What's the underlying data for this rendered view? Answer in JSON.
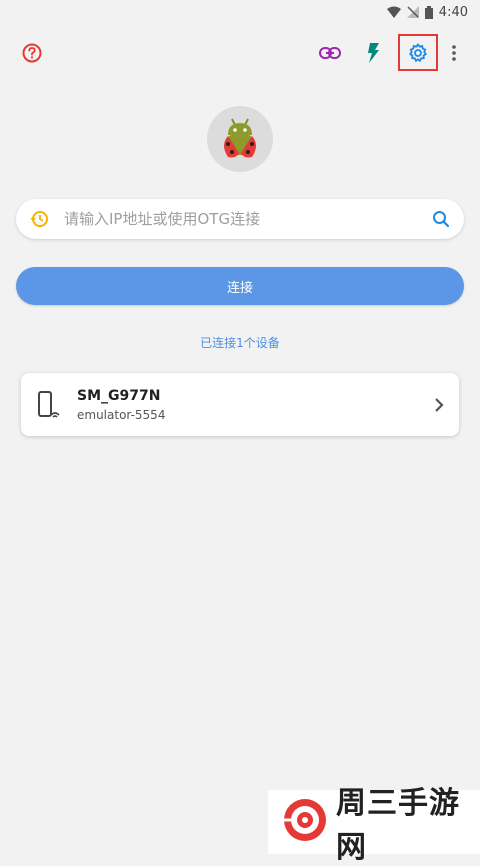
{
  "status_bar": {
    "time": "4:40"
  },
  "toolbar": {
    "help_icon": "help-circle-icon",
    "link_icon": "link-icon",
    "flash_icon": "flash-icon",
    "settings_icon": "gear-icon",
    "more_icon": "more-vert-icon"
  },
  "search": {
    "placeholder": "请输入IP地址或使用OTG连接",
    "value": ""
  },
  "connect_button": {
    "label": "连接"
  },
  "connected_status": "已连接1个设备",
  "devices": [
    {
      "name": "SM_G977N",
      "serial": "emulator-5554"
    }
  ],
  "watermark": {
    "text": "周三手游网"
  },
  "colors": {
    "accent": "#5b97e6",
    "highlight": "#e53935",
    "background": "#f2f2f2"
  }
}
